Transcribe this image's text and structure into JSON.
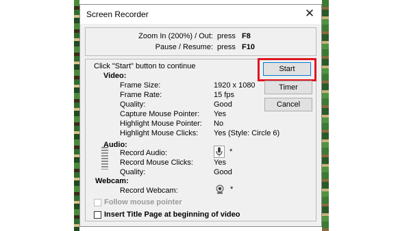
{
  "window": {
    "title": "Screen Recorder"
  },
  "hotkeys": [
    {
      "label": "Zoom In (200%) / Out:",
      "press": "press",
      "key": "F8"
    },
    {
      "label": "Pause / Resume:",
      "press": "press",
      "key": "F10"
    }
  ],
  "instruction": "Click \"Start\" button to continue",
  "buttons": {
    "start": "Start",
    "timer": "Timer",
    "cancel": "Cancel"
  },
  "video": {
    "heading": "Video:",
    "rows": [
      {
        "label": "Frame Size:",
        "value": "1920 x 1080"
      },
      {
        "label": "Frame Rate:",
        "value": "15 fps"
      },
      {
        "label": "Quality:",
        "value": "Good"
      },
      {
        "label": "Capture Mouse Pointer:",
        "value": "Yes"
      },
      {
        "label": "Highlight Mouse Pointer:",
        "value": "No"
      },
      {
        "label": "Highlight Mouse Clicks:",
        "value": "Yes (Style: Circle 6)"
      }
    ]
  },
  "audio": {
    "heading": "Audio:",
    "rows": [
      {
        "label": "Record Audio:",
        "value": "*"
      },
      {
        "label": "Record Mouse Clicks:",
        "value": "Yes"
      },
      {
        "label": "Quality:",
        "value": "Good"
      }
    ]
  },
  "webcam": {
    "heading": "Webcam:",
    "rows": [
      {
        "label": "Record Webcam:",
        "value": "*"
      }
    ]
  },
  "options": {
    "follow_mouse": {
      "label": "Follow mouse pointer",
      "checked": false,
      "enabled": false
    },
    "title_page": {
      "label": "Insert Title Page at beginning of video",
      "checked": false,
      "enabled": true
    }
  },
  "icons": {
    "close": "close-icon",
    "microphone": "microphone-icon",
    "webcam": "webcam-icon",
    "audio_meter": "audio-level-meter"
  },
  "colors": {
    "highlight": "#e0141e",
    "dialog_bg": "#f0f0f0"
  }
}
